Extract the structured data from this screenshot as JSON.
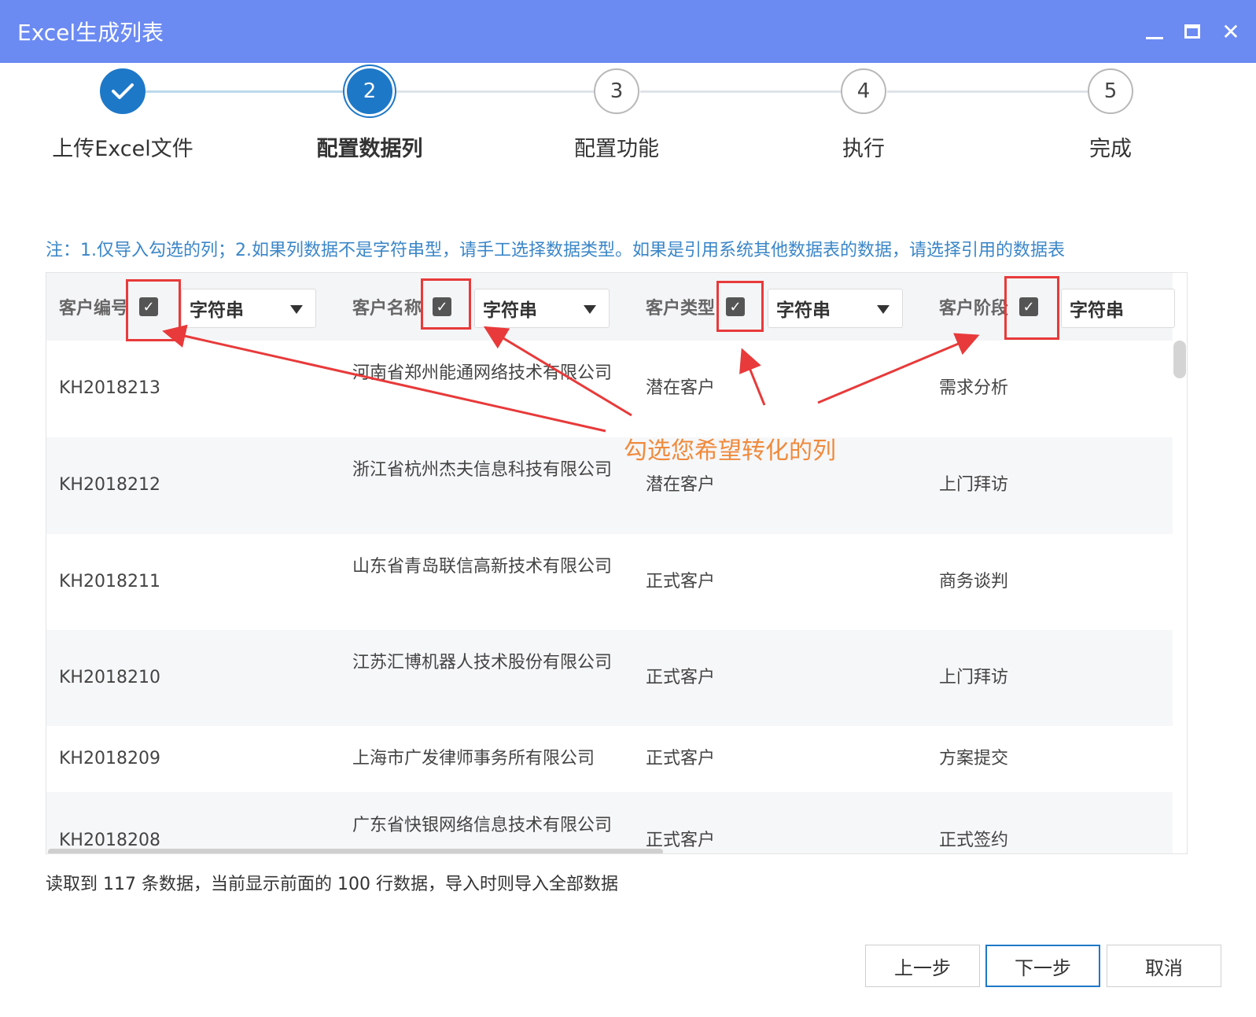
{
  "window": {
    "title": "Excel生成列表",
    "icons": {
      "minimize": "minimize-icon",
      "maximize": "maximize-icon",
      "close": "close-icon"
    }
  },
  "steps": [
    {
      "number": "✓",
      "label": "上传Excel文件",
      "state": "done"
    },
    {
      "number": "2",
      "label": "配置数据列",
      "state": "active"
    },
    {
      "number": "3",
      "label": "配置功能",
      "state": "pending"
    },
    {
      "number": "4",
      "label": "执行",
      "state": "pending"
    },
    {
      "number": "5",
      "label": "完成",
      "state": "pending"
    }
  ],
  "note": "注：1.仅导入勾选的列；2.如果列数据不是字符串型，请手工选择数据类型。如果是引用系统其他数据表的数据，请选择引用的数据表",
  "columns": [
    {
      "label": "客户编号",
      "checked": true,
      "type": "字符串"
    },
    {
      "label": "客户名称",
      "checked": true,
      "type": "字符串"
    },
    {
      "label": "客户类型",
      "checked": true,
      "type": "字符串"
    },
    {
      "label": "客户阶段",
      "checked": true,
      "type": "字符串"
    }
  ],
  "checkmark": "✓",
  "rows": [
    [
      "KH2018213",
      "河南省郑州能通网络技术有限公司",
      "潜在客户",
      "需求分析"
    ],
    [
      "KH2018212",
      "浙江省杭州杰夫信息科技有限公司",
      "潜在客户",
      "上门拜访"
    ],
    [
      "KH2018211",
      "山东省青岛联信高新技术有限公司",
      "正式客户",
      "商务谈判"
    ],
    [
      "KH2018210",
      "江苏汇博机器人技术股份有限公司",
      "正式客户",
      "上门拜访"
    ],
    [
      "KH2018209",
      "上海市广发律师事务所有限公司",
      "正式客户",
      "方案提交"
    ],
    [
      "KH2018208",
      "广东省快银网络信息技术有限公司",
      "正式客户",
      "正式签约"
    ]
  ],
  "annotation": {
    "callout": "勾选您希望转化的列",
    "color": "#e83a3a",
    "text_color": "#f08a3c"
  },
  "summary": "读取到 117 条数据，当前显示前面的 100 行数据，导入时则导入全部数据",
  "buttons": {
    "prev": "上一步",
    "next": "下一步",
    "cancel": "取消"
  },
  "colors": {
    "titlebar": "#6b8af2",
    "accent": "#1e78c8",
    "note": "#3a86c8"
  }
}
